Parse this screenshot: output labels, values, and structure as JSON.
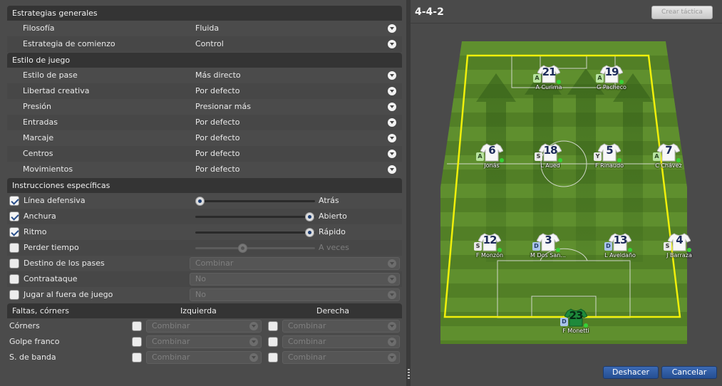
{
  "general": {
    "header": "Estrategias generales",
    "rows": [
      {
        "label": "Filosofía",
        "value": "Fluida"
      },
      {
        "label": "Estrategia de comienzo",
        "value": "Control"
      }
    ]
  },
  "style": {
    "header": "Estilo de juego",
    "rows": [
      {
        "label": "Estilo de pase",
        "value": "Más directo"
      },
      {
        "label": "Libertad creativa",
        "value": "Por defecto"
      },
      {
        "label": "Presión",
        "value": "Presionar más"
      },
      {
        "label": "Entradas",
        "value": "Por defecto"
      },
      {
        "label": "Marcaje",
        "value": "Por defecto"
      },
      {
        "label": "Centros",
        "value": "Por defecto"
      },
      {
        "label": "Movimientos",
        "value": "Por defecto"
      }
    ]
  },
  "specific": {
    "header": "Instrucciones específicas",
    "defensive_line": {
      "label": "Línea defensiva",
      "value": "Atrás",
      "checked": true,
      "level": 0.0
    },
    "width": {
      "label": "Anchura",
      "value": "Abierto",
      "checked": true,
      "level": 1.0
    },
    "tempo": {
      "label": "Ritmo",
      "value": "Rápido",
      "checked": true,
      "level": 1.0
    },
    "time_waste": {
      "label": "Perder tiempo",
      "value": "A veces",
      "checked": false,
      "level": 0.5
    },
    "pass_target": {
      "label": "Destino de los pases",
      "value": "Combinar",
      "checked": false
    },
    "counter": {
      "label": "Contraataque",
      "value": "No",
      "checked": false
    },
    "offside": {
      "label": "Jugar al fuera de juego",
      "value": "No",
      "checked": false
    }
  },
  "set_pieces": {
    "header": "Faltas, córners",
    "col_left": "Izquierda",
    "col_right": "Derecha",
    "rows": [
      {
        "label": "Córners",
        "left": "Combinar",
        "right": "Combinar"
      },
      {
        "label": "Golpe franco",
        "left": "Combinar",
        "right": "Combinar"
      },
      {
        "label": "S. de banda",
        "left": "Combinar",
        "right": "Combinar"
      }
    ]
  },
  "tactic": {
    "formation": "4-4-2",
    "create_button": "Crear táctica",
    "undo_button": "Deshacer",
    "cancel_button": "Cancelar"
  },
  "players": [
    {
      "number": "21",
      "name": "A Curima",
      "role": "A",
      "line": "forward",
      "slot": 0
    },
    {
      "number": "19",
      "name": "G Pacheco",
      "role": "A",
      "line": "forward",
      "slot": 1
    },
    {
      "number": "6",
      "name": "Jonás",
      "role": "A",
      "line": "mid",
      "slot": 0
    },
    {
      "number": "18",
      "name": "L Aued",
      "role": "S",
      "line": "mid",
      "slot": 1
    },
    {
      "number": "5",
      "name": "F Rinaudo",
      "role": "Y",
      "line": "mid",
      "slot": 2
    },
    {
      "number": "7",
      "name": "C Chávez",
      "role": "A",
      "line": "mid",
      "slot": 3
    },
    {
      "number": "12",
      "name": "F Monzón",
      "role": "S",
      "line": "def",
      "slot": 0
    },
    {
      "number": "3",
      "name": "M Dos San...",
      "role": "D",
      "line": "def",
      "slot": 1
    },
    {
      "number": "13",
      "name": "L Aveldaño",
      "role": "D",
      "line": "def",
      "slot": 2
    },
    {
      "number": "4",
      "name": "J Barraza",
      "role": "S",
      "line": "def",
      "slot": 3
    },
    {
      "number": "23",
      "name": "F Monetti",
      "role": "D",
      "line": "gk",
      "slot": 0
    }
  ],
  "colors": {
    "pitch_light": "#5e8f2c",
    "pitch_dark": "#4c7a22",
    "outline": "#f2f20a",
    "accent_blue": "#2b5aa3"
  }
}
